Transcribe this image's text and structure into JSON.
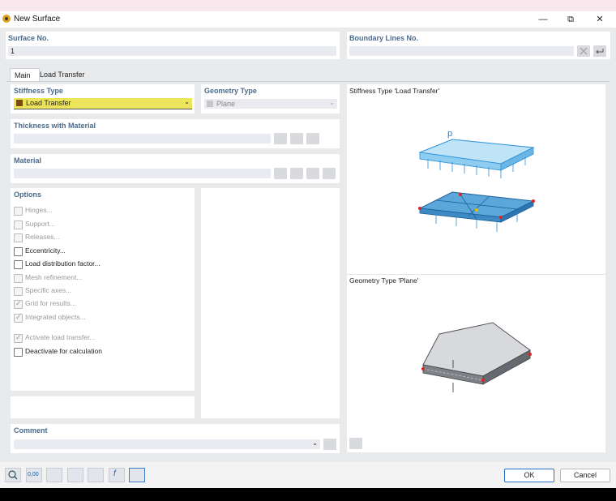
{
  "window": {
    "title": "New Surface",
    "minimize": "—",
    "restore": "⧉",
    "close": "✕"
  },
  "surface_no": {
    "label": "Surface No.",
    "value": "1"
  },
  "boundary_lines": {
    "label": "Boundary Lines No.",
    "value": ""
  },
  "tabs": [
    {
      "label": "Main"
    },
    {
      "label": "Load Transfer"
    }
  ],
  "stiffness": {
    "label": "Stiffness Type",
    "value": "Load Transfer",
    "swatch": "#7a4a12",
    "highlight": "#ece45a"
  },
  "geometry": {
    "label": "Geometry Type",
    "value": "Plane"
  },
  "thickness": {
    "label": "Thickness with Material"
  },
  "material": {
    "label": "Material"
  },
  "options": {
    "label": "Options",
    "items": [
      {
        "label": "Hinges...",
        "checked": false,
        "enabled": false
      },
      {
        "label": "Support...",
        "checked": false,
        "enabled": false
      },
      {
        "label": "Releases...",
        "checked": false,
        "enabled": false
      },
      {
        "label": "Eccentricity...",
        "checked": false,
        "enabled": true
      },
      {
        "label": "Load distribution factor...",
        "checked": false,
        "enabled": true
      },
      {
        "label": "Mesh refinement...",
        "checked": false,
        "enabled": false
      },
      {
        "label": "Specific axes...",
        "checked": false,
        "enabled": false
      },
      {
        "label": "Grid for results...",
        "checked": true,
        "enabled": false
      },
      {
        "label": "Integrated objects...",
        "checked": true,
        "enabled": false
      },
      {
        "label": "Activate load transfer...",
        "checked": true,
        "enabled": false
      },
      {
        "label": "Deactivate for calculation",
        "checked": false,
        "enabled": true
      }
    ]
  },
  "comment": {
    "label": "Comment",
    "value": ""
  },
  "preview": {
    "stiffness_caption": "Stiffness Type 'Load Transfer'",
    "geometry_caption": "Geometry Type 'Plane'",
    "load_symbol": "p"
  },
  "buttons": {
    "ok": "OK",
    "cancel": "Cancel"
  },
  "bottom_icons": [
    "search-icon",
    "units-icon",
    "grid-icon",
    "display-icon",
    "model-icon",
    "function-icon",
    "view-icon"
  ],
  "bottom_icon_text": {
    "units": "0,00"
  }
}
